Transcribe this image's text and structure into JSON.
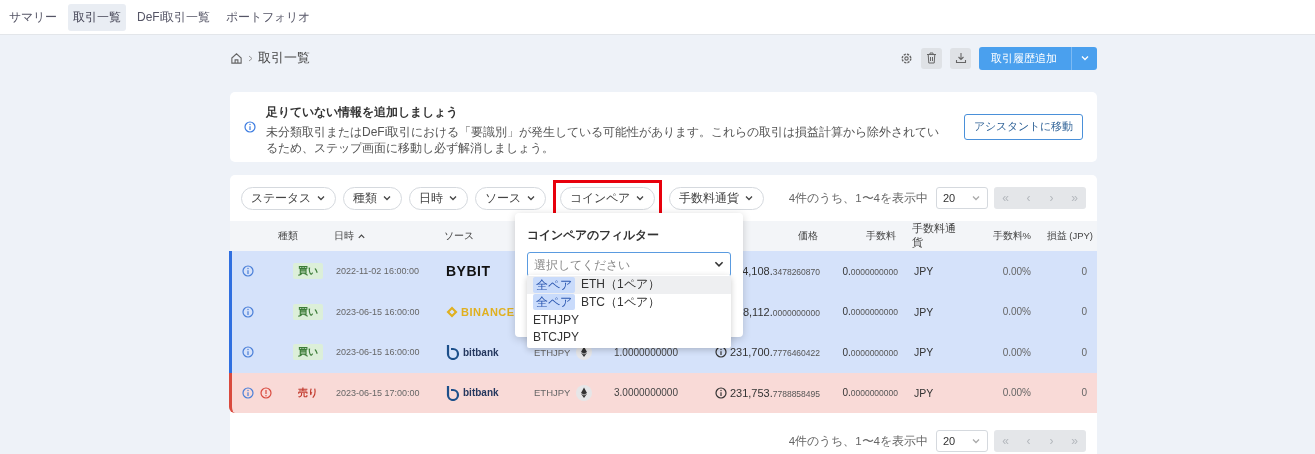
{
  "nav": {
    "tabs": [
      {
        "label": "サマリー",
        "selected": false
      },
      {
        "label": "取引一覧",
        "selected": true
      },
      {
        "label": "DeFi取引一覧",
        "selected": false
      },
      {
        "label": "ポートフォリオ",
        "selected": false
      }
    ]
  },
  "breadcrumb": {
    "current": "取引一覧"
  },
  "toolbar": {
    "add_button": "取引履歴追加"
  },
  "alert": {
    "title": "足りていない情報を追加しましょう",
    "body": "未分類取引またはDeFi取引における「要識別」が発生している可能性があります。これらの取引は損益計算から除外されているため、ステップ画面に移動し必ず解消しましょう。",
    "button": "アシスタントに移動"
  },
  "filters": [
    {
      "label": "ステータス",
      "highlighted": false
    },
    {
      "label": "種類",
      "highlighted": false
    },
    {
      "label": "日時",
      "highlighted": false
    },
    {
      "label": "ソース",
      "highlighted": false
    },
    {
      "label": "コインペア",
      "highlighted": true
    },
    {
      "label": "手数料通貨",
      "highlighted": false
    }
  ],
  "pagination_top": {
    "summary": "4件のうち、1〜4を表示中",
    "page_size": "20",
    "buttons": [
      {
        "label": "«",
        "disabled": true
      },
      {
        "label": "‹",
        "disabled": true
      },
      {
        "label": "›",
        "disabled": true
      },
      {
        "label": "»",
        "disabled": true
      }
    ]
  },
  "table": {
    "columns": [
      {
        "label": "種類",
        "sorted": false
      },
      {
        "label": "日時",
        "sorted": true
      },
      {
        "label": "ソース",
        "sorted": false
      },
      {
        "label": "価格",
        "sorted": false
      },
      {
        "label": "手数料",
        "sorted": false
      },
      {
        "label": "手数料通貨",
        "sorted": false
      },
      {
        "label": "手数料%",
        "sorted": false
      },
      {
        "label": "損益 (JPY)",
        "sorted": false
      }
    ],
    "rows": [
      {
        "kind": "buy",
        "warning": false,
        "type": "買い",
        "date": "2022-11-02 16:00:00",
        "source": {
          "kind": "bybit",
          "text": "BYBIT"
        },
        "price_icon": false,
        "price": "4,108.3478260870",
        "fee": "0.0000000000",
        "fee_currency": "JPY",
        "fee_percent": "0.00%",
        "pnl": "0"
      },
      {
        "kind": "buy",
        "warning": false,
        "type": "買い",
        "date": "2023-06-15 16:00:00",
        "source": {
          "kind": "binance",
          "text": "BINANCE"
        },
        "price_icon": false,
        "price": "8,112.0000000000",
        "fee": "0.0000000000",
        "fee_currency": "JPY",
        "fee_percent": "0.00%",
        "pnl": "0"
      },
      {
        "kind": "buy",
        "warning": false,
        "type": "買い",
        "date": "2023-06-15 16:00:00",
        "source": {
          "kind": "bitbank",
          "text": "bitbank"
        },
        "pair": "ETHJPY",
        "quantity": "1.0000000000",
        "price_icon": true,
        "price": "231,700.7776460422",
        "fee": "0.0000000000",
        "fee_currency": "JPY",
        "fee_percent": "0.00%",
        "pnl": "0"
      },
      {
        "kind": "sell",
        "warning": true,
        "type": "売り",
        "date": "2023-06-15 17:00:00",
        "source": {
          "kind": "bitbank",
          "text": "bitbank"
        },
        "pair": "ETHJPY",
        "quantity": "3.0000000000",
        "price_icon": true,
        "price": "231,753.7788858495",
        "fee": "0.0000000000",
        "fee_currency": "JPY",
        "fee_percent": "0.00%",
        "pnl": "0"
      }
    ]
  },
  "coin_filter": {
    "title": "コインペアのフィルター",
    "placeholder": "選択してください",
    "options": [
      {
        "kind": "group",
        "tag": "全ペア",
        "label": "ETH（1ペア）",
        "selected": true
      },
      {
        "kind": "group",
        "tag": "全ペア",
        "label": "BTC（1ペア）",
        "selected": false
      },
      {
        "kind": "pair",
        "label": "ETHJPY",
        "selected": false
      },
      {
        "kind": "pair",
        "label": "BTCJPY",
        "selected": false
      }
    ]
  },
  "pagination_bottom": {
    "summary": "4件のうち、1〜4を表示中",
    "page_size": "20",
    "buttons": [
      {
        "label": "«",
        "disabled": true
      },
      {
        "label": "‹",
        "disabled": true
      },
      {
        "label": "›",
        "disabled": true
      },
      {
        "label": "»",
        "disabled": true
      }
    ]
  }
}
